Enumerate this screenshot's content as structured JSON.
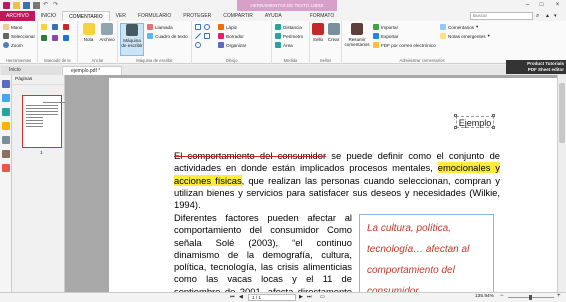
{
  "window": {
    "title": "ejemplo.pdf * - Foxit Reader",
    "context_tab": "HERRAMIENTAS DE TEXTO LIBRE"
  },
  "menu_tabs": [
    "ARCHIVO",
    "INICIO",
    "COMENTARIO",
    "VER",
    "FORMULARIO",
    "PROTEGER",
    "COMPARTIR",
    "AYUDA",
    "FORMATO"
  ],
  "search": {
    "placeholder": "Buscar"
  },
  "ribbon": {
    "herramientas": {
      "items": [
        "Mano",
        "Seleccionar",
        "Zoom"
      ],
      "caption": "Herramientas"
    },
    "marcado": {
      "caption": "Marcado de te"
    },
    "anclar": {
      "items": [
        "Nota",
        "Archivo"
      ],
      "caption": "Anclar"
    },
    "maquina": {
      "large": "Máquina de escribir",
      "items": [
        "Llamada",
        "Cuadro de texto"
      ],
      "caption": "Máquina de escribir"
    },
    "dibujo": {
      "items": [
        "Lápiz",
        "Borrador",
        "Organizar"
      ],
      "caption": "Dibujo"
    },
    "medida": {
      "items": [
        "Distancia",
        "Perímetro",
        "Área"
      ],
      "caption": "Medida"
    },
    "sellos": {
      "items": [
        "Sello",
        "Crear"
      ],
      "caption": "Sellos"
    },
    "admin": {
      "items": [
        "Resumir comentarios",
        "Importar",
        "Exportar",
        "FDF por correo electrónico",
        "Comentarios",
        "Notas emergentes"
      ],
      "caption": "Administrar comentarios"
    }
  },
  "doc_tabs": [
    "Inicio",
    "ejemplo.pdf *"
  ],
  "banner": {
    "line1": "Product Tutorials",
    "line2": "PDF Sheet editor"
  },
  "pages_panel": {
    "header": "Páginas",
    "page_number": "1"
  },
  "document": {
    "ejemplo_box": "Ejemplo",
    "para1_strike": "El comportamiento del consumidor",
    "para1_a": " se puede definir como el conjunto de actividades  en donde están implicados procesos mentales, ",
    "para1_hl": "emocionales y acciones físicas",
    "para1_b": ", que realizan las personas cuando seleccionan, compran y utilizan bienes y servicios para satisfacer sus deseos y necesidades (Wilkie, 1994).",
    "para2": "Diferentes factores pueden afectar al comportamiento del consumidor Como señala Solé (2003), “el continuo dinamismo de la demografía, cultura, política, tecnología, las crisis alimenticias como las vacas locas y el 11 de septiembre de 2001, afecta directamente al consumidor en su",
    "quote": "La cultura, política, tecnología… afectan al comportamiento del consumidor"
  },
  "status": {
    "page": "1 / 1",
    "zoom": "135.94%"
  }
}
